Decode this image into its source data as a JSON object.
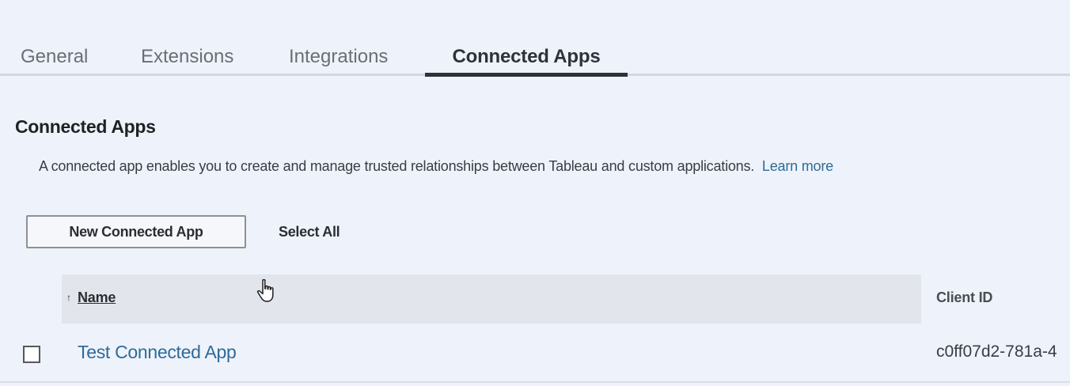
{
  "tabs": {
    "general": "General",
    "extensions": "Extensions",
    "integrations": "Integrations",
    "connected_apps": "Connected Apps",
    "active": "connected_apps"
  },
  "section": {
    "title": "Connected Apps",
    "description": "A connected app enables you to create and manage trusted relationships between Tableau and custom applications.",
    "learn_more": "Learn more"
  },
  "actions": {
    "new_connected_app": "New Connected App",
    "select_all": "Select All"
  },
  "table": {
    "sort_indicator": "↑",
    "columns": {
      "name": "Name",
      "client_id": "Client ID"
    },
    "rows": [
      {
        "name": "Test Connected App",
        "client_id": "c0ff07d2-781a-4",
        "checked": false
      }
    ]
  },
  "colors": {
    "background": "#eef3fb",
    "link": "#2f6a98",
    "active_tab_underline": "#2f3237",
    "header_bg": "#e2e6ec"
  },
  "icons": {
    "cursor": "hand-pointer-icon"
  }
}
